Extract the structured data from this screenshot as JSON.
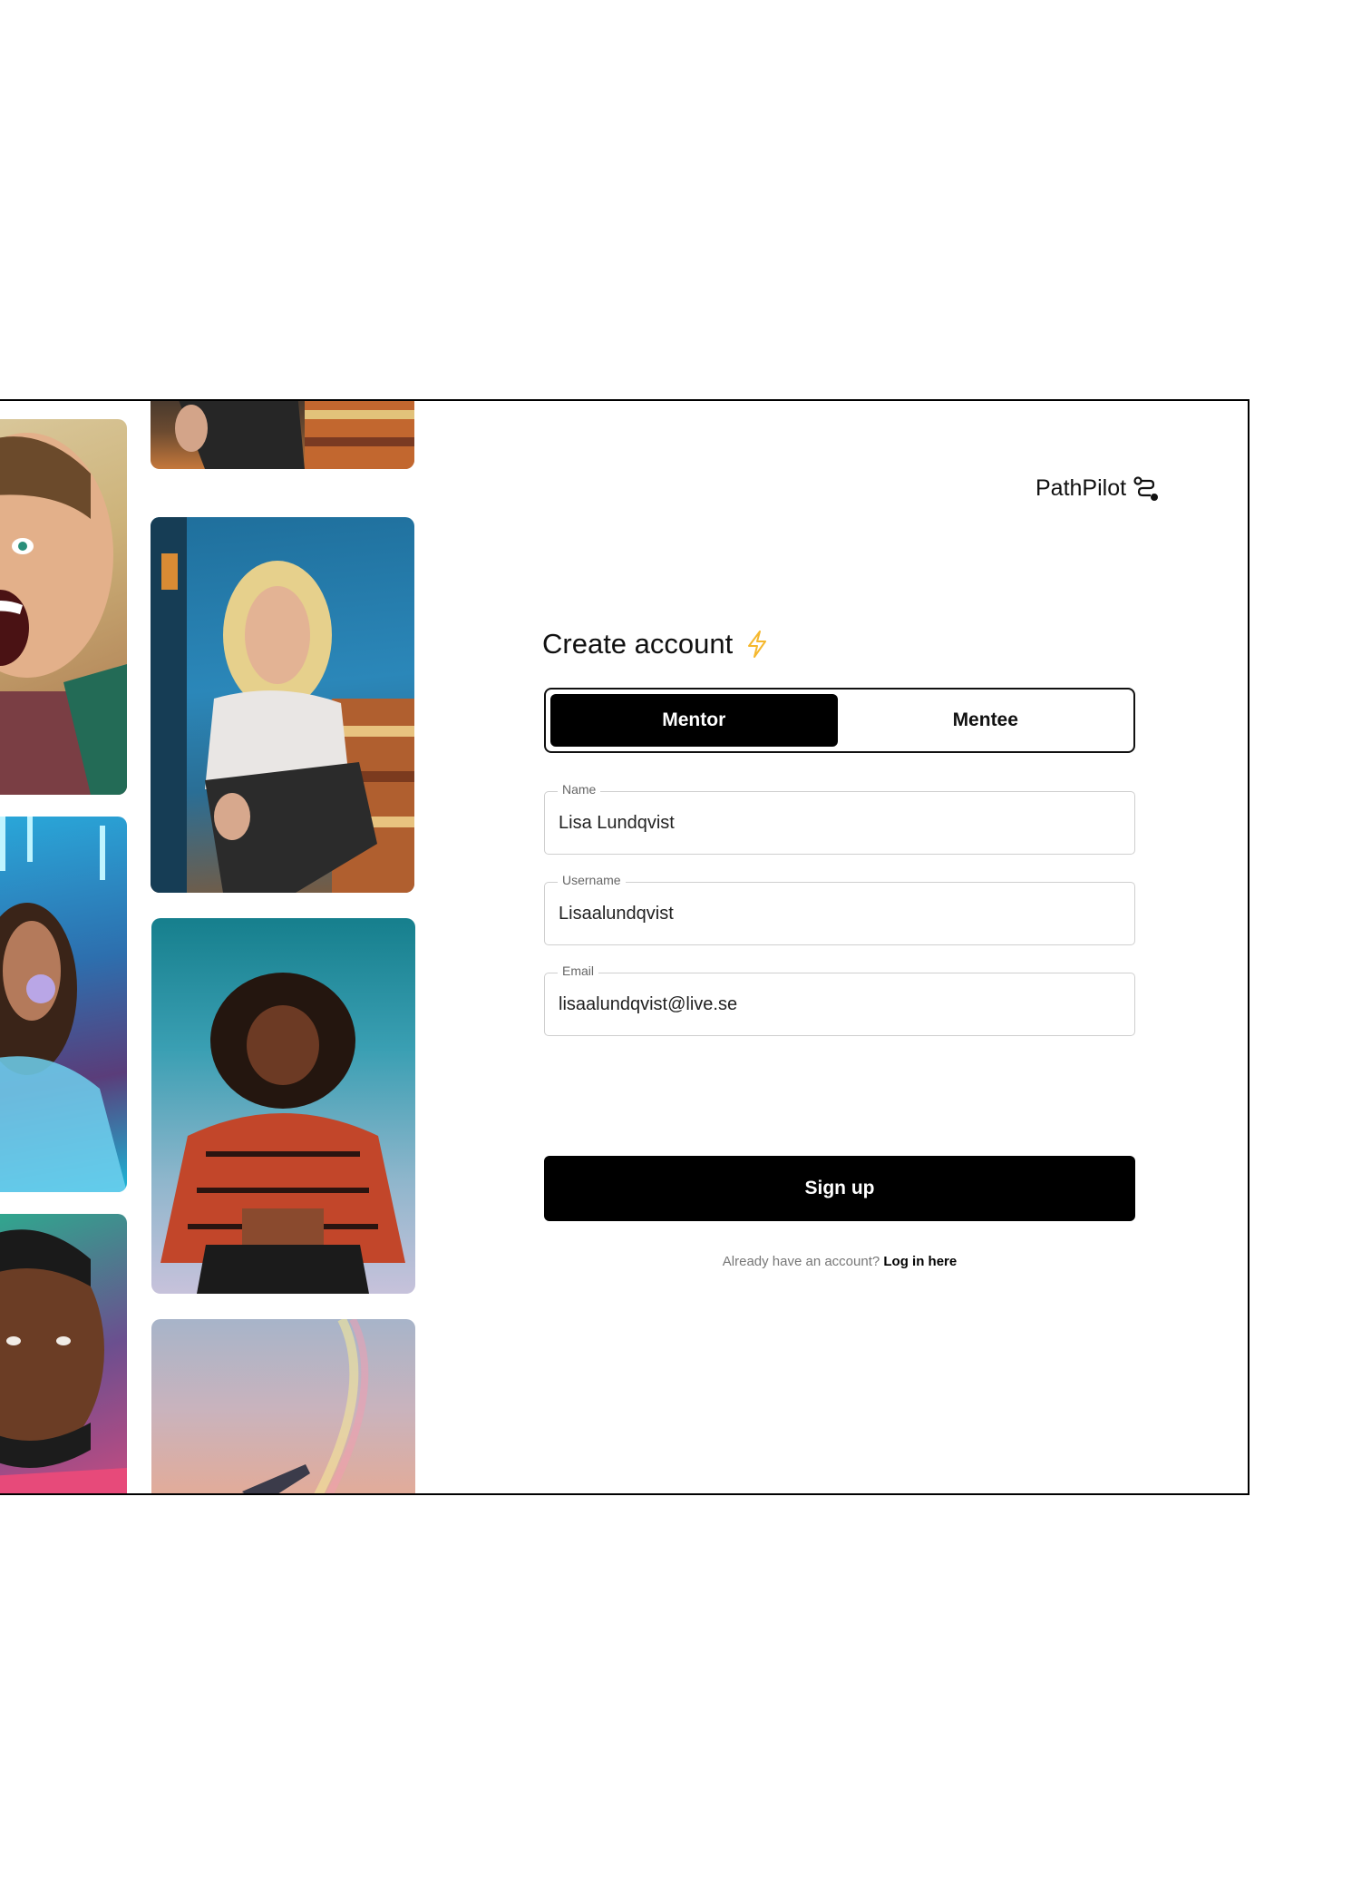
{
  "brand": {
    "name": "PathPilot",
    "icon": "route-icon"
  },
  "form": {
    "title": "Create account",
    "title_icon": "lightning-bolt-icon",
    "accent_color": "#f5b82e",
    "role_toggle": {
      "options": [
        "Mentor",
        "Mentee"
      ],
      "selected": "Mentor"
    },
    "fields": {
      "name": {
        "label": "Name",
        "value": "Lisa Lundqvist"
      },
      "username": {
        "label": "Username",
        "value": "Lisaalundqvist"
      },
      "email": {
        "label": "Email",
        "value": "lisaalundqvist@live.se"
      }
    },
    "submit_label": "Sign up",
    "login_prompt": "Already have an account?",
    "login_link": "Log in here"
  },
  "gallery": {
    "photos": [
      "excited-man-photo",
      "woman-bubblegum-photo",
      "man-portrait-photo",
      "woman-sofa-cropped-photo",
      "woman-sofa-photo",
      "woman-red-sweater-photo",
      "rainbow-sky-photo"
    ]
  }
}
